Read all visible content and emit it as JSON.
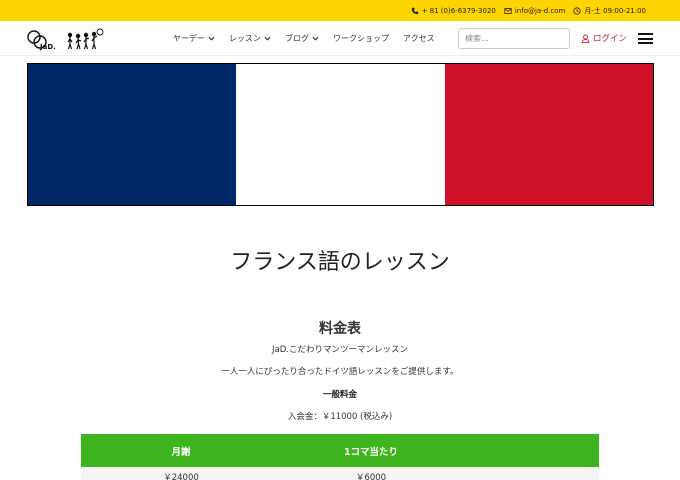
{
  "topbar": {
    "phone": "+ 81 (0)6-6379-3020",
    "email": "info@ja-d.com",
    "hours": "月-土 09:00-21:00"
  },
  "nav": {
    "logo_text": "JaD.",
    "items": [
      {
        "label": "ヤーデー",
        "dropdown": true
      },
      {
        "label": "レッスン",
        "dropdown": true
      },
      {
        "label": "ブログ",
        "dropdown": true
      },
      {
        "label": "ワークショップ",
        "dropdown": false
      },
      {
        "label": "アクセス",
        "dropdown": false
      }
    ],
    "search_placeholder": "検索...",
    "login_label": "ログイン"
  },
  "flag": {
    "colors": [
      "#002868",
      "#ffffff",
      "#ce1126"
    ]
  },
  "main": {
    "title": "フランス語のレッスン",
    "section_title": "料金表",
    "subtitle": "JaD.こだわりマンツーマンレッスン",
    "description": "一人一人にぴったり合ったドイツ語レッスンをご提供します。",
    "general_label": "一般料金",
    "entry_fee": "入会金：￥11000 (税込み)"
  },
  "table": {
    "headers": [
      "月謝",
      "1コマ当たり"
    ],
    "header_color": "#3eb51f",
    "rows": [
      [
        "￥24000",
        "￥6000"
      ]
    ]
  }
}
